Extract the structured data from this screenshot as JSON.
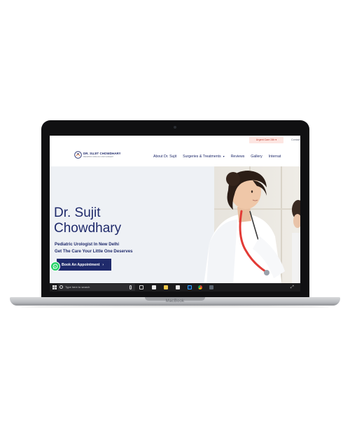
{
  "device": {
    "brand": "MacBook"
  },
  "site": {
    "topbar": {
      "urgent_label": "Urgent Care 24h",
      "contact_label": "Contact"
    },
    "logo": {
      "name": "DR. SUJIT CHOWDHARY",
      "tagline": "PEDIATRIC UROLOGY AND SURGERY"
    },
    "nav": {
      "items": [
        {
          "label": "About Dr. Sujit",
          "dropdown": false
        },
        {
          "label": "Surgeries & Treatments",
          "dropdown": true
        },
        {
          "label": "Reviews",
          "dropdown": false
        },
        {
          "label": "Gallery",
          "dropdown": false
        },
        {
          "label": "Internat",
          "dropdown": false
        }
      ],
      "caret_glyph": "▾"
    },
    "hero": {
      "title_line1": "Dr. Sujit",
      "title_line2": "Chowdhary",
      "subtitle_line1": "Pediatric Urologist In New Delhi",
      "subtitle_line2": "Get The Care Your Little One Deserves",
      "cta_label": "Book An Appointment",
      "cta_arrow": "›"
    }
  },
  "taskbar": {
    "search_placeholder": "Type here to search",
    "expand_glyph": "⤢",
    "icons": [
      "task-view-icon",
      "edge-icon",
      "file-explorer-icon",
      "store-icon",
      "photoshop-icon",
      "chrome-icon",
      "app-icon"
    ]
  },
  "colors": {
    "brand_navy": "#1f2a6b",
    "urgent_bg": "#fde6e2",
    "whatsapp_green": "#25d366",
    "taskbar": "#1b1b1d"
  }
}
